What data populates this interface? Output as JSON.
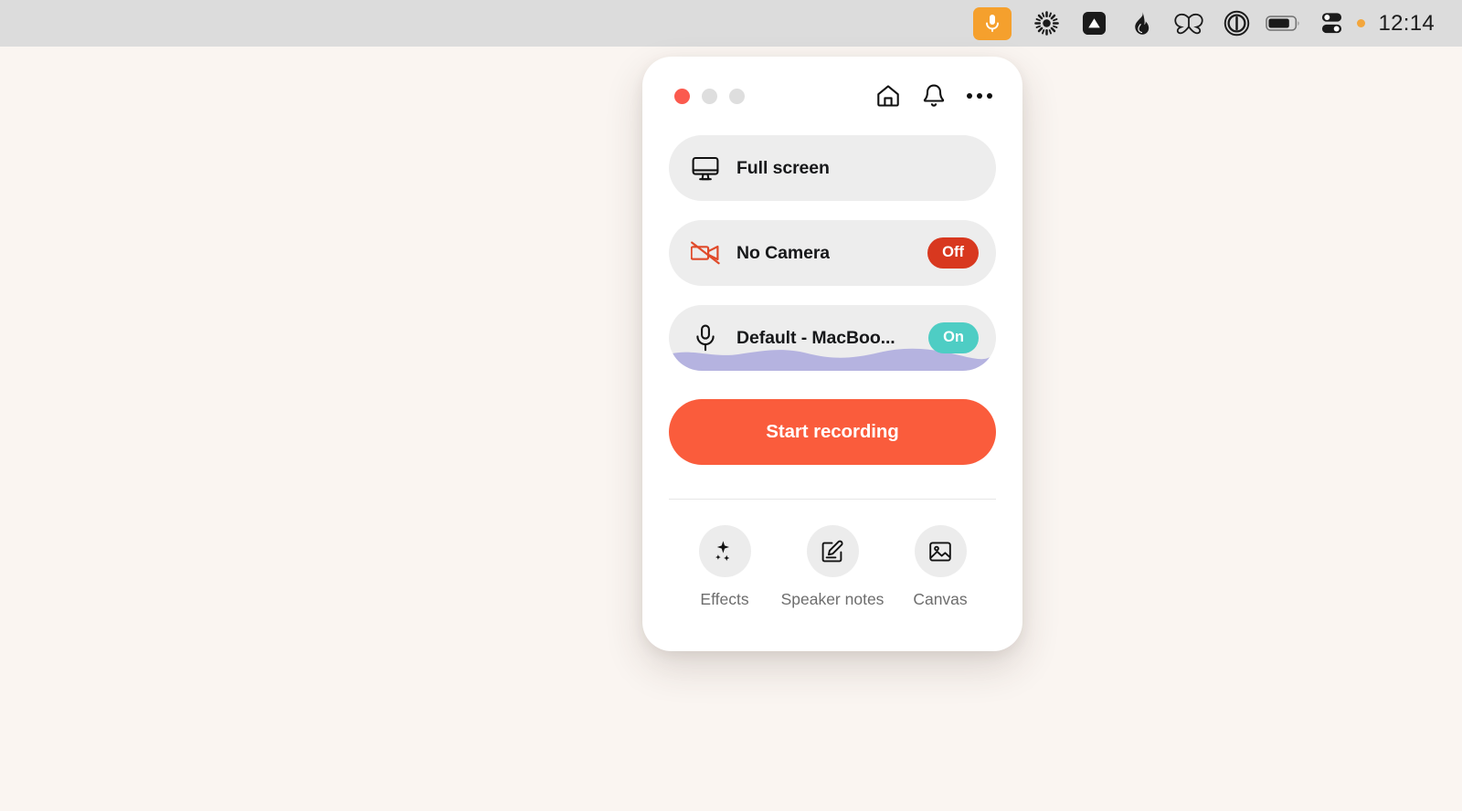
{
  "menubar": {
    "icons": [
      {
        "name": "microphone-active-icon",
        "label": "Microphone in use"
      },
      {
        "name": "sun-burst-icon",
        "label": "Display brightness"
      },
      {
        "name": "drive-triangle-icon",
        "label": "Cloud drive"
      },
      {
        "name": "flame-icon",
        "label": "Flame"
      },
      {
        "name": "butterfly-icon",
        "label": "Butterfly"
      },
      {
        "name": "power-circle-icon",
        "label": "Power"
      },
      {
        "name": "battery-icon",
        "label": "Battery"
      },
      {
        "name": "control-center-icon",
        "label": "Control Center"
      }
    ],
    "status_dot_color": "#f3a63c",
    "mic_badge_color": "#f5a02d",
    "clock": "12:14",
    "background": "#dcdcdc"
  },
  "desktop": {
    "background": "#faf5f1"
  },
  "app": {
    "window_controls": {
      "close_color": "#fb5a4e",
      "minimize_color": "#dedede",
      "zoom_color": "#dedede"
    },
    "header_actions": [
      {
        "name": "home-icon",
        "label": "Home"
      },
      {
        "name": "bell-icon",
        "label": "Notifications"
      },
      {
        "name": "more-options-icon",
        "label": "More options"
      }
    ],
    "options": [
      {
        "icon": "monitor-icon",
        "label": "Full screen",
        "badge": null,
        "badge_state": null
      },
      {
        "icon": "camera-off-icon",
        "label": "No Camera",
        "badge": "Off",
        "badge_state": "off",
        "badge_color": "#d8381f"
      },
      {
        "icon": "microphone-icon",
        "label": "Default - MacBoo...",
        "badge": "On",
        "badge_state": "on",
        "badge_color": "#4ecdc4",
        "audio_wave_color": "#b5b3e0"
      }
    ],
    "primary_action": {
      "label": "Start recording",
      "color": "#fa5c3c"
    },
    "tools": [
      {
        "icon": "sparkles-icon",
        "label": "Effects"
      },
      {
        "icon": "note-pencil-icon",
        "label": "Speaker notes"
      },
      {
        "icon": "image-icon",
        "label": "Canvas"
      }
    ]
  }
}
